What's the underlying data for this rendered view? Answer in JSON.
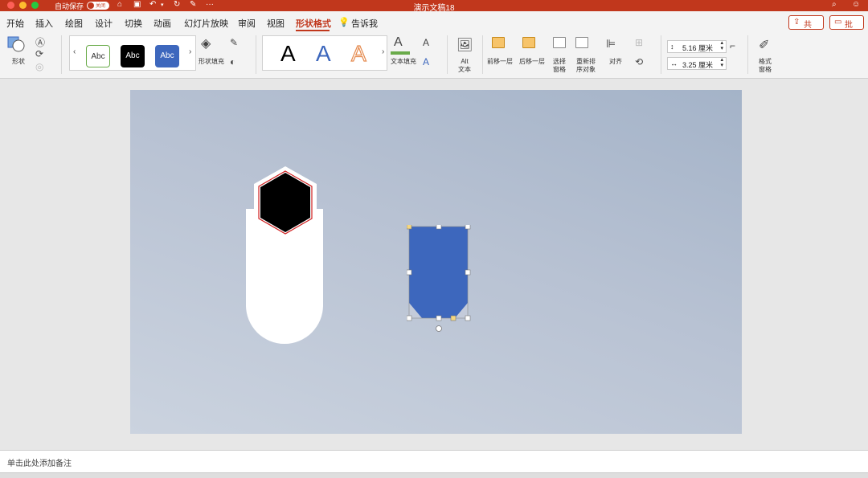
{
  "titlebar": {
    "autosave_label": "自动保存",
    "autosave_state": "关闭",
    "doc_title": "演示文稿18"
  },
  "tabs": [
    "开始",
    "插入",
    "绘图",
    "设计",
    "切换",
    "动画",
    "幻灯片放映",
    "审阅",
    "视图",
    "形状格式",
    "告诉我"
  ],
  "active_tab": "形状格式",
  "header_buttons": {
    "share": "共享",
    "comment": "批注"
  },
  "ribbon": {
    "shape_label": "形状",
    "style_previews": [
      "Abc",
      "Abc",
      "Abc"
    ],
    "shape_fill_label": "形状填充",
    "wordart_previews": [
      "A",
      "A",
      "A"
    ],
    "text_fill_label": "文本填充",
    "alt_text_label": "Alt\n文本",
    "bring_forward_label": "前移一层",
    "send_backward_label": "后移一层",
    "selection_pane_label": "选择\n窗格",
    "reorder_label": "重新排\n序对象",
    "align_label": "对齐",
    "height_value": "5.16 厘米",
    "width_value": "3.25 厘米",
    "format_pane_label": "格式\n窗格"
  },
  "notes_placeholder": "单击此处添加备注",
  "colors": {
    "accent": "#c1371c",
    "shape_blue": "#3d67bd",
    "slide_bg_top": "#a4b3c8",
    "slide_bg_bottom": "#cbd3df",
    "hex_fill": "#000000",
    "hex_outline": "#d02020"
  }
}
